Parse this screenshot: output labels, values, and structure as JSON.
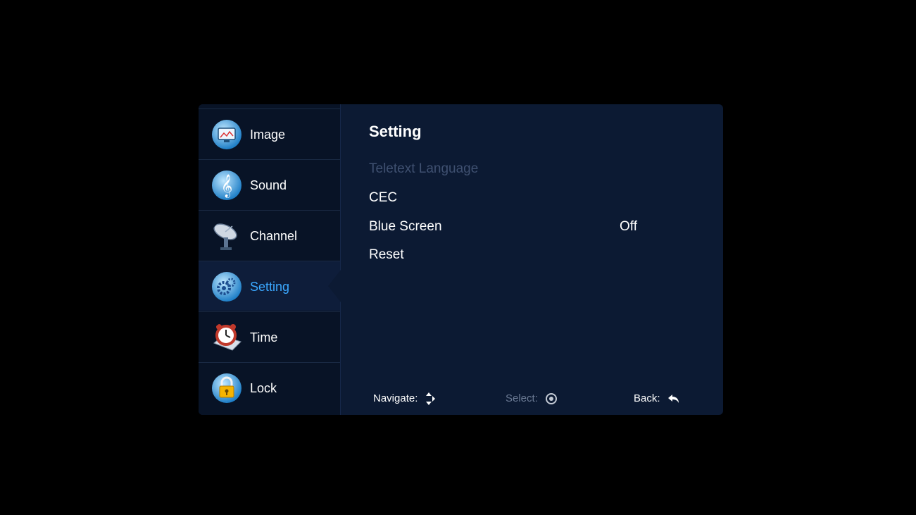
{
  "sidebar": {
    "items": [
      {
        "label": "Image",
        "icon": "image-icon"
      },
      {
        "label": "Sound",
        "icon": "music-note-icon"
      },
      {
        "label": "Channel",
        "icon": "satellite-dish-icon"
      },
      {
        "label": "Setting",
        "icon": "gears-icon",
        "active": true
      },
      {
        "label": "Time",
        "icon": "alarm-clock-icon"
      },
      {
        "label": "Lock",
        "icon": "padlock-icon"
      }
    ]
  },
  "main": {
    "title": "Setting",
    "options": [
      {
        "label": "Teletext Language",
        "disabled": true
      },
      {
        "label": "CEC"
      },
      {
        "label": "Blue Screen",
        "value": "Off"
      },
      {
        "label": "Reset"
      }
    ]
  },
  "footer": {
    "navigate": "Navigate:",
    "select": "Select:",
    "back": "Back:"
  },
  "colors": {
    "accent": "#3ba8ff",
    "panel": "#0c1a33",
    "sidebar": "#081326"
  }
}
